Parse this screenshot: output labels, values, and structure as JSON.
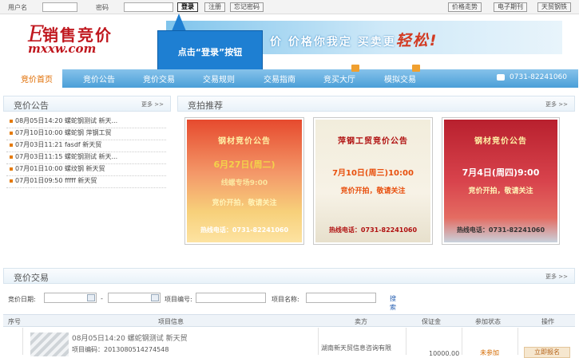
{
  "topbar": {
    "username_label": "用户名",
    "password_label": "密码",
    "login_button": "登录",
    "register_button": "注册",
    "forgot_button": "忘记密码",
    "right_links": [
      "价格走势",
      "电子期刊",
      "天贸钢铁"
    ]
  },
  "header": {
    "logo_mark": "E",
    "logo_cn": "销售竞价",
    "logo_en": "mxxw.com",
    "banner_text": "价  价格你我定   买卖更",
    "banner_emphasis": "轻松!"
  },
  "callout": {
    "text": "点击“登录”按钮"
  },
  "nav": {
    "items": [
      "竞价首页",
      "竞价公告",
      "竞价交易",
      "交易规则",
      "交易指南",
      "竞买大厅",
      "模拟交易"
    ],
    "phone": "0731-82241060"
  },
  "notice_panel": {
    "title": "竞价公告",
    "more": "更多 >>",
    "items": [
      "08月05日14:20 螺蛇钢测试 新天...",
      "07月10日10:00 螺蛇钢 萍钢工贸",
      "07月03日11:21 fasdf 新天贸",
      "07月03日11:15 螺蛇钢测试 新天...",
      "07月01日10:00 螺纹钢 新天贸",
      "07月01日09:50 fffff 新天贸"
    ]
  },
  "recommend_panel": {
    "title": "竞拍推荐",
    "more": "更多 >>",
    "cards": [
      {
        "title": "钢材竞价公告",
        "date": "6月27日(周二)",
        "line": "线螺专场9:00",
        "sub": "竞价开拍，敬请关注",
        "hotline": "热线电话：0731-82241060",
        "bg": "#e9845a"
      },
      {
        "title": "萍钢工贸竞价公告",
        "date": "7月10日(周三)10:00",
        "line": "竞价开拍，敬请关注",
        "sub": "",
        "hotline": "热线电话：0731-82241060",
        "bg": "#f6f0e0"
      },
      {
        "title": "钢材竞价公告",
        "date": "7月4日(周四)9:00",
        "line": "竞价开拍，敬请关注",
        "sub": "",
        "hotline": "热线电话：0731-82241060",
        "bg": "#c7283a"
      }
    ]
  },
  "trade_panel": {
    "title": "竞价交易",
    "more": "更多 >>",
    "search": {
      "date_label": "竞价日期:",
      "dash": "-",
      "item_no_label": "项目编号:",
      "item_name_label": "项目名称:",
      "search_link": "搜 索"
    },
    "columns": [
      "序号",
      "项目信息",
      "卖方",
      "保证金",
      "参加状态",
      "操作"
    ],
    "rows": [
      {
        "line1": "08月05日14:20 螺蛇钢测试 新天贸",
        "line2": "项目编码：2013080514274548",
        "seller": "湖南新天贸信息咨询有限",
        "deposit": "10000.00",
        "status": "未参加",
        "action": "立即报名"
      }
    ]
  }
}
